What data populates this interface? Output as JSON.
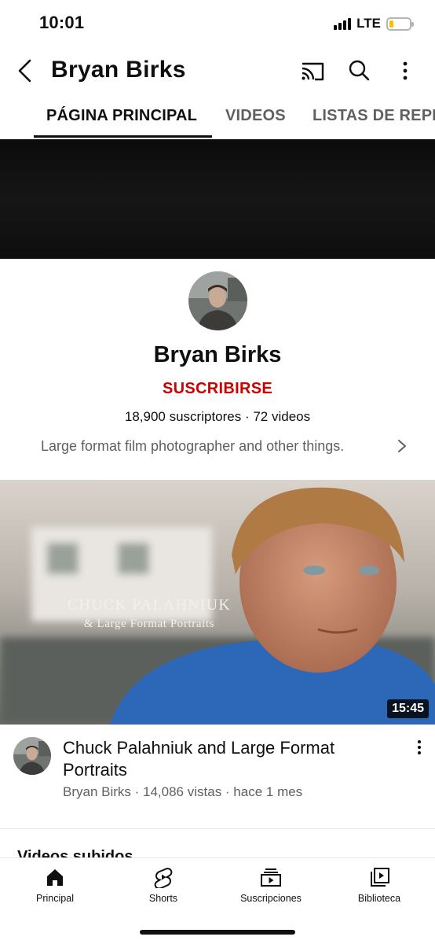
{
  "status_bar": {
    "time": "10:01",
    "network": "LTE",
    "battery_level": 0.2,
    "battery_color": "#f2c200"
  },
  "header": {
    "back_icon": "chevron-left-icon",
    "title": "Bryan Birks",
    "icons": [
      "cast-icon",
      "search-icon",
      "more-vertical-icon"
    ]
  },
  "tabs": [
    {
      "label": "PÁGINA PRINCIPAL",
      "active": true
    },
    {
      "label": "VIDEOS",
      "active": false
    },
    {
      "label": "LISTAS DE REPR",
      "active": false
    }
  ],
  "channel": {
    "name": "Bryan Birks",
    "subscribe_label": "SUSCRIBIRSE",
    "subscribe_color": "#cc0000",
    "stats": "18,900 suscriptores · 72 videos",
    "description": "Large format film photographer and other things."
  },
  "featured_video": {
    "thumbnail_line1": "CHUCK PALAHNIUK",
    "thumbnail_line2": "& Large Format Portraits",
    "duration": "15:45",
    "title": "Chuck Palahniuk and Large Format Portraits",
    "meta": "Bryan Birks · 14,086 vistas · hace 1 mes"
  },
  "next_section_label": "Videos subidos",
  "bottom_nav": [
    {
      "label": "Principal",
      "icon": "home-icon"
    },
    {
      "label": "Shorts",
      "icon": "shorts-icon"
    },
    {
      "label": "Suscripciones",
      "icon": "subscriptions-icon"
    },
    {
      "label": "Biblioteca",
      "icon": "library-icon"
    }
  ]
}
